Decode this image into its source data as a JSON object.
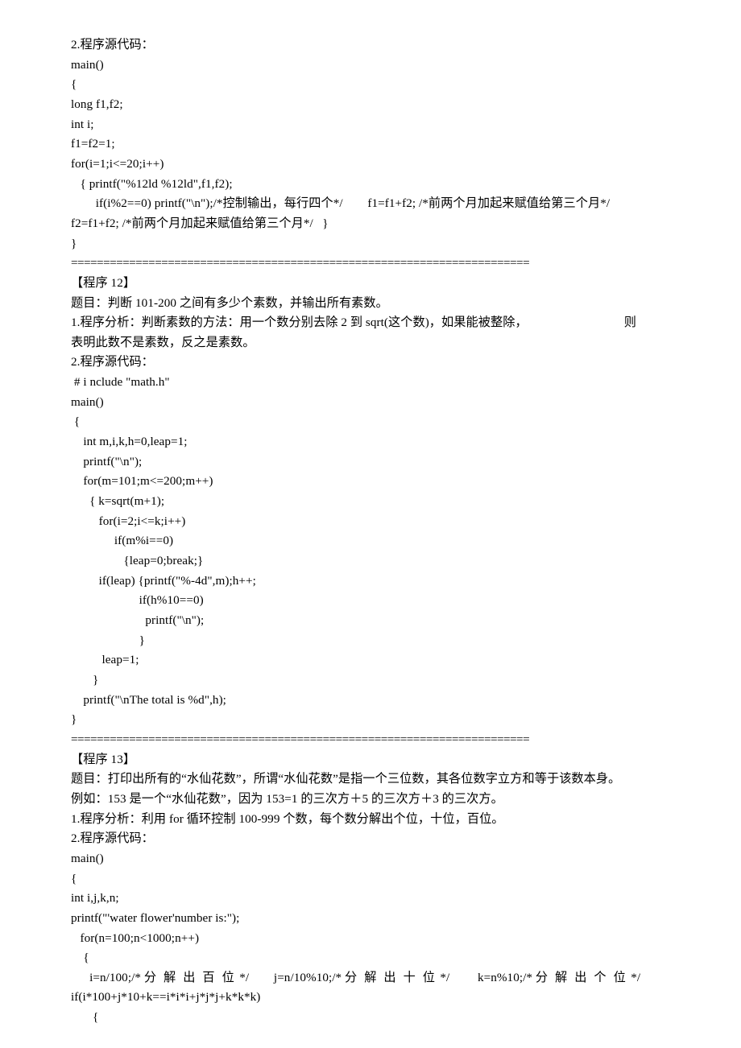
{
  "document": {
    "page_background": "#ffffff",
    "text_color": "#000000",
    "separator_char": "=",
    "separator_repeat": 71
  },
  "blocks": [
    {
      "id": "program11-source",
      "kind": "code",
      "lines": [
        "2.程序源代码：",
        "main()",
        "{",
        "long f1,f2;",
        "int i;",
        "f1=f2=1;",
        "for(i=1;i<=20;i++)",
        "   { printf(\"%12ld %12ld\",f1,f2);",
        "        if(i%2==0) printf(\"\\n\");/*控制输出，每行四个*/        f1=f1+f2; /*前两个月加起来赋值给第三个月*/          f2=f1+f2; /*前两个月加起来赋值给第三个月*/   }",
        "}"
      ]
    },
    {
      "id": "separator-1",
      "kind": "separator"
    },
    {
      "id": "program12-header",
      "kind": "text",
      "lines": [
        "【程序 12】",
        "题目：判断 101-200 之间有多少个素数，并输出所有素数。"
      ]
    },
    {
      "id": "program12-analysis",
      "kind": "text",
      "prefix": "1.程序分析：判断素数的方法：用一个数分别去除 2 到 sqrt(这个数)，如果能被整除，",
      "gap_then": "则",
      "continuation": "表明此数不是素数，反之是素数。"
    },
    {
      "id": "program12-source",
      "kind": "code",
      "lines": [
        "2.程序源代码：",
        " # i nclude \"math.h\"",
        "main()",
        " {",
        "    int m,i,k,h=0,leap=1;",
        "    printf(\"\\n\");",
        "    for(m=101;m<=200;m++)",
        "      { k=sqrt(m+1);",
        "         for(i=2;i<=k;i++)",
        "              if(m%i==0)",
        "                 {leap=0;break;}",
        "         if(leap) {printf(\"%-4d\",m);h++;",
        "                      if(h%10==0)",
        "                        printf(\"\\n\");",
        "                      }",
        "          leap=1;",
        "       }",
        "    printf(\"\\nThe total is %d\",h);",
        "}"
      ]
    },
    {
      "id": "separator-2",
      "kind": "separator"
    },
    {
      "id": "program13-header",
      "kind": "text",
      "lines": [
        "【程序 13】",
        "题目：打印出所有的“水仙花数”，所谓“水仙花数”是指一个三位数，其各位数字立方和等于该数本身。",
        "例如：153 是一个“水仙花数”，因为 153=1 的三次方＋5 的三次方＋3 的三次方。",
        "1.程序分析：利用 for 循环控制 100-999 个数，每个数分解出个位，十位，百位。"
      ]
    },
    {
      "id": "program13-source",
      "kind": "code",
      "lines": [
        "2.程序源代码：",
        "main()",
        "{",
        "int i,j,k,n;",
        "printf(\"'water flower'number is:\");",
        "   for(n=100;n<1000;n++)",
        "    {"
      ]
    },
    {
      "id": "program13-decompose",
      "kind": "code-spaced",
      "seg1": "      i=n/100;/* ",
      "seg1_spaced": "分 解 出 百 位",
      "seg2": " */        j=n/10%10;/* ",
      "seg2_spaced": "分 解 出 十 位",
      "seg3": " */         k=n%10;/* ",
      "seg3_spaced": "分 解 出 个 位",
      "seg4": " */     if(i*100+j*10+k==i*i*i+j*j*j+k*k*k)"
    },
    {
      "id": "program13-open-brace",
      "kind": "code",
      "lines": [
        "       {"
      ]
    }
  ]
}
